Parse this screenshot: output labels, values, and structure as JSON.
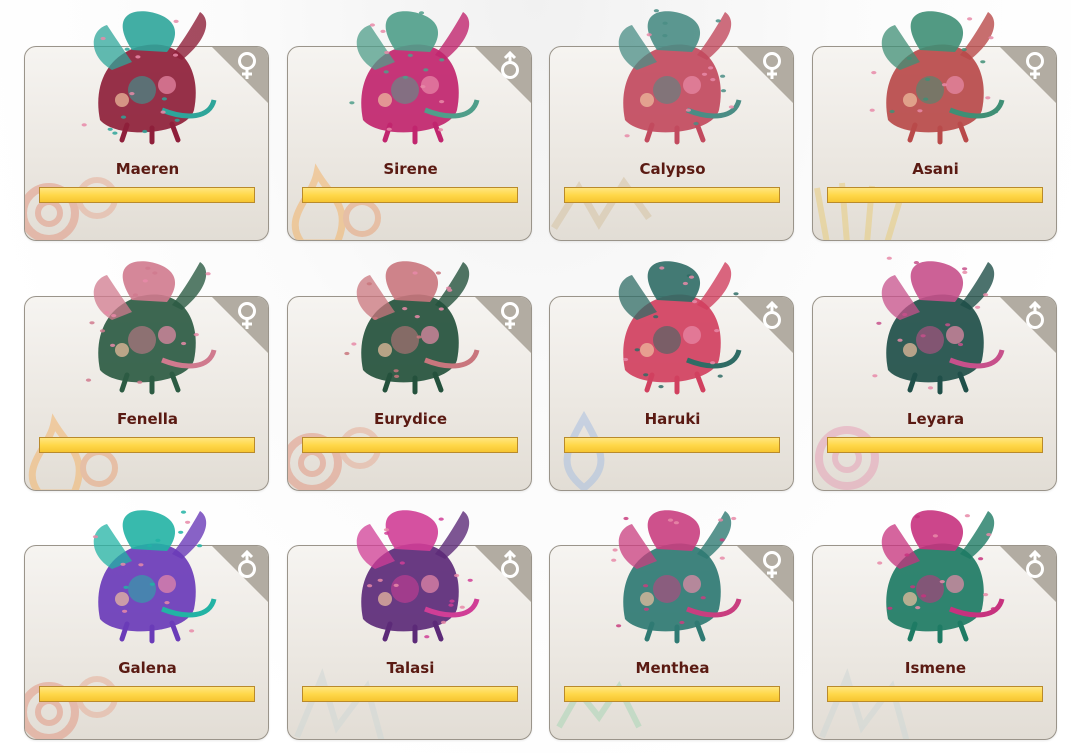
{
  "colors": {
    "name_text": "#5a1a12",
    "bar_fill": "#ffd84a",
    "card_border": "#9a948a",
    "corner_tab": "#b2aca2"
  },
  "dragons": [
    {
      "name": "Maeren",
      "gender": "female",
      "gender_icon": "female-icon",
      "element": "swirl-red-icon",
      "hue": "#8e1f3a",
      "accent": "#2ea59a",
      "energy": 1.0
    },
    {
      "name": "Sirene",
      "gender": "male",
      "gender_icon": "male-icon",
      "element": "flame-orange-icon",
      "hue": "#c1256e",
      "accent": "#4f9e8a",
      "energy": 1.0
    },
    {
      "name": "Calypso",
      "gender": "female",
      "gender_icon": "female-icon",
      "element": "zigzag-tan-icon",
      "hue": "#c24a5e",
      "accent": "#4a8d85",
      "energy": 1.0
    },
    {
      "name": "Asani",
      "gender": "female",
      "gender_icon": "female-icon",
      "element": "sunburst-gold-icon",
      "hue": "#b94a4a",
      "accent": "#3f8f75",
      "energy": 1.0
    },
    {
      "name": "Fenella",
      "gender": "female",
      "gender_icon": "female-icon",
      "element": "flame-orange-icon",
      "hue": "#2c5b43",
      "accent": "#d07a8e",
      "energy": 1.0
    },
    {
      "name": "Eurydice",
      "gender": "female",
      "gender_icon": "female-icon",
      "element": "swirl-red-icon",
      "hue": "#24513c",
      "accent": "#c9767d",
      "energy": 1.0
    },
    {
      "name": "Haruki",
      "gender": "male",
      "gender_icon": "male-icon",
      "element": "droplet-blue-icon",
      "hue": "#d1405f",
      "accent": "#2f6c65",
      "energy": 1.0
    },
    {
      "name": "Leyara",
      "gender": "male",
      "gender_icon": "male-icon",
      "element": "swirl-pink-icon",
      "hue": "#1f4f49",
      "accent": "#c7508b",
      "energy": 1.0
    },
    {
      "name": "Galena",
      "gender": "male",
      "gender_icon": "male-icon",
      "element": "swirl-red-icon",
      "hue": "#6a3bb8",
      "accent": "#22b3a4",
      "energy": 1.0
    },
    {
      "name": "Talasi",
      "gender": "male",
      "gender_icon": "male-icon",
      "element": "star-ice-icon",
      "hue": "#5c2a78",
      "accent": "#d03e96",
      "energy": 1.0
    },
    {
      "name": "Menthea",
      "gender": "female",
      "gender_icon": "female-icon",
      "element": "glyph-green-icon",
      "hue": "#2f7a73",
      "accent": "#c93e7f",
      "energy": 1.0
    },
    {
      "name": "Ismene",
      "gender": "male",
      "gender_icon": "male-icon",
      "element": "star-ice-icon",
      "hue": "#1e7b64",
      "accent": "#c7327e",
      "energy": 1.0
    }
  ]
}
